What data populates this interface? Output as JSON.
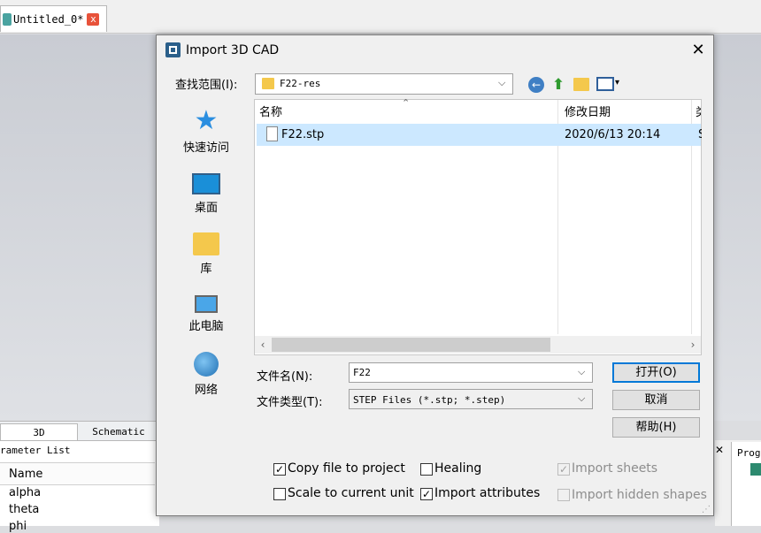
{
  "app": {
    "doc_tab": "Untitled_0*",
    "doc_tab_close": "x",
    "bottom_tabs": [
      "3D",
      "Schematic"
    ],
    "param_panel_title": "rameter List",
    "param_column": "Name",
    "params": [
      "alpha",
      "theta",
      "phi"
    ],
    "right_panel_close": "✕",
    "prog_panel_title": "Prog"
  },
  "dialog": {
    "title": "Import 3D CAD",
    "close": "✕",
    "look_in_label": "查找范围(I):",
    "look_in_value": "F22-res",
    "combo_arrow": "⌵",
    "toolbar": {
      "back": "←",
      "up": "⬆",
      "views_arrow": "▾"
    },
    "places": [
      "快速访问",
      "桌面",
      "库",
      "此电脑",
      "网络"
    ],
    "columns": {
      "name": "名称",
      "modified": "修改日期",
      "extra": "类"
    },
    "sort_arrow": "⌃",
    "files": [
      {
        "name": "F22.stp",
        "modified": "2020/6/13 20:14",
        "extra": "S"
      }
    ],
    "scroll": {
      "left": "‹",
      "right": "›"
    },
    "filename_label": "文件名(N):",
    "filename_value": "F22",
    "filetype_label": "文件类型(T):",
    "filetype_value": "STEP Files (*.stp; *.step)",
    "buttons": {
      "open": "打开(O)",
      "cancel": "取消",
      "help": "帮助(H)"
    },
    "options": [
      {
        "label": "Copy file to project",
        "checked": true,
        "enabled": true
      },
      {
        "label": "Healing",
        "checked": false,
        "enabled": true
      },
      {
        "label": "Import sheets",
        "checked": true,
        "enabled": false
      },
      {
        "label": "Scale to current unit",
        "checked": false,
        "enabled": true
      },
      {
        "label": "Import attributes",
        "checked": true,
        "enabled": true
      },
      {
        "label": "Import hidden shapes",
        "checked": false,
        "enabled": false
      }
    ],
    "check_mark": "✓",
    "grip": "⋰"
  }
}
